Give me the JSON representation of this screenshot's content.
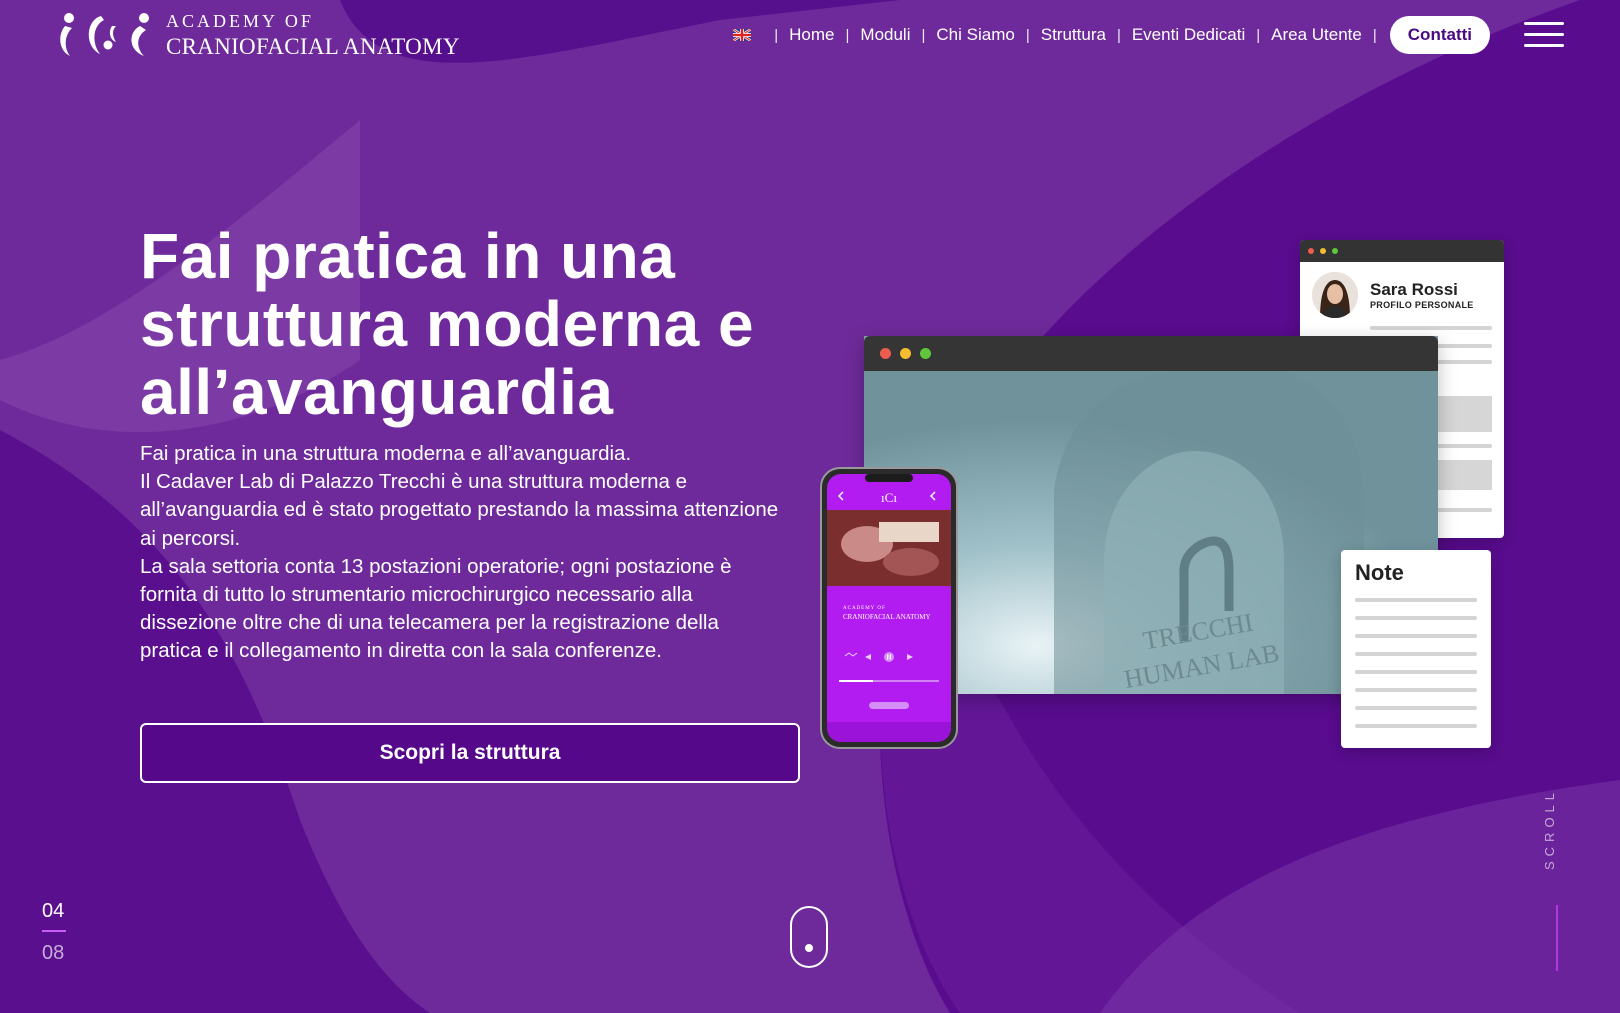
{
  "brand": {
    "line1": "ACADEMY OF",
    "line2": "CRANIOFACIAL ANATOMY",
    "mark_icon": "aca-logo-mark"
  },
  "nav": {
    "language_icon": "uk-flag-icon",
    "separator": "|",
    "items": [
      "Home",
      "Moduli",
      "Chi Siamo",
      "Struttura",
      "Eventi Dedicati",
      "Area Utente"
    ],
    "contact_label": "Contatti",
    "menu_icon": "hamburger-menu-icon"
  },
  "hero": {
    "title": "Fai pratica in una struttura moderna e all’avanguardia",
    "paragraphs": [
      "Fai pratica in una struttura moderna e all’avanguardia.",
      "Il Cadaver Lab di Palazzo Trecchi è una struttura moderna e all’avanguardia ed è stato progettato prestando la massima attenzione ai percorsi.",
      "La sala settoria conta 13 postazioni operatorie; ogni postazione è fornita di tutto lo strumentario microchirurgico necessario alla dissezione oltre che di una telecamera per la registrazione della pratica e il collegamento in diretta con la sala conferenze."
    ],
    "cta_label": "Scopri la struttura"
  },
  "mockups": {
    "profile": {
      "name": "Sara Rossi",
      "subtitle": "PROFILO PERSONALE"
    },
    "note": {
      "title": "Note"
    },
    "video": {
      "caption_1": "TRECCHI",
      "caption_2": "HUMAN LAB"
    },
    "phone": {
      "logo": "ıCı",
      "line1": "ACADEMY OF",
      "line2": "CRANIOFACIAL ANATOMY"
    }
  },
  "pager": {
    "current": "04",
    "total": "08"
  },
  "scroll": {
    "label": "SCROLL",
    "icon": "mouse-scroll-icon"
  },
  "colors": {
    "background": "#6e2a9a",
    "deep": "#55088a",
    "accent": "#c65cf2",
    "button_text": "#4a0b80"
  }
}
